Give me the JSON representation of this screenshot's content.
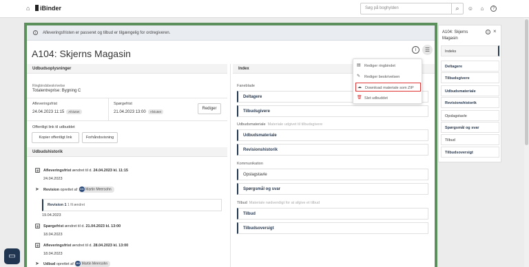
{
  "header": {
    "logo": "iBinder",
    "search_placeholder": "Søg på boghylden",
    "icons": [
      "home-icon",
      "search-icon",
      "user-icon",
      "bank-icon",
      "help-icon"
    ]
  },
  "alert": {
    "text": "Afleveringsfristen er passeret og tilbud er tilgængelig for ordregiveren."
  },
  "page_title": "A104: Skjerns Magasin",
  "left": {
    "section_title": "Udbudsoplysninger",
    "ringbind_label": "Ringbindsbeskrivelse",
    "ringbind_value": "Totalentreprise: Bygning C",
    "deadline_label": "Afleveringsfrist",
    "deadline_value": "24.04.2023 11:15",
    "deadline_badge": "Afsluttet",
    "question_label": "Spørgefrist",
    "question_value": "21.04.2023 13:00",
    "question_badge": "Afsluttet",
    "edit_button": "Rediger",
    "public_link_label": "Offentligt link til udbuddet",
    "copy_link_button": "Kopier offentligt link",
    "preview_button": "Forhåndsvisning",
    "history_title": "Udbudshistorik",
    "history": [
      {
        "bold": "Afleveringsfrist",
        "text": "ændret til d.",
        "value": "24.04.2023 kl. 11:15",
        "date": "24.04.2023"
      },
      {
        "bold": "Revision",
        "text": "oprettet af",
        "user_initials": "MM",
        "user": "Martin Meersohn"
      },
      {
        "revision_label": "Revision 1",
        "revision_note": "1 fil ændret",
        "date": "19.04.2023"
      },
      {
        "bold": "Spørgefrist",
        "text": "ændret til d.",
        "value": "21.04.2023 kl. 13:00",
        "date": "18.04.2023"
      },
      {
        "bold": "Afleveringsfrist",
        "text": "ændret til d.",
        "value": "28.04.2023 kl. 13:00",
        "date": "18.04.2023"
      },
      {
        "bold": "Udbud",
        "text": "oprettet af",
        "user_initials": "MM",
        "user": "Martin Meersohn"
      }
    ]
  },
  "index": {
    "title": "Index",
    "group_faneblade": "Faneblade",
    "group_udbud": "Udbudsmateriale",
    "group_udbud_note": "Materiale udgivet til tilbudsgivere",
    "group_komm": "Kommunikation",
    "group_tilbud": "Tilbud",
    "group_tilbud_note": "Materiale nødvendigt for at afgive et tilbud",
    "items": [
      "Deltagere",
      "Tilbudsgivere",
      "Udbudsmateriale",
      "Revisionshistorik",
      "Opslagstavle",
      "Spørgsmål og svar",
      "Tilbud",
      "Tilbudsoversigt"
    ]
  },
  "menu": {
    "items": [
      "Rediger ringbindet",
      "Rediger beskrivelsen",
      "Download materiale som ZIP",
      "Slet udbuddet"
    ]
  },
  "side": {
    "title": "A104: Skjerns Magasin",
    "items": [
      "Indeks",
      "Deltagere",
      "Tilbudsgivere",
      "Udbudsmateriale",
      "Revisionshistorik",
      "Opslagstavle",
      "Spørgsmål og svar",
      "Tilbud",
      "Tilbudsoversigt"
    ]
  }
}
